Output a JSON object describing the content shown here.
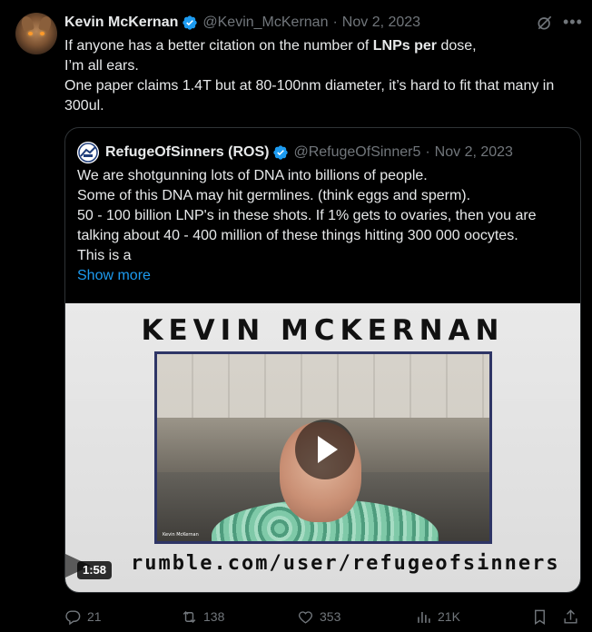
{
  "tweet": {
    "author_name": "Kevin McKernan",
    "handle": "@Kevin_McKernan",
    "date": "Nov 2, 2023",
    "text_line1_a": "If anyone has a better citation on the number of ",
    "text_line1_bold": "LNPs per",
    "text_line1_b": " dose,",
    "text_line2": "I’m all ears.",
    "text_line3": "One paper claims 1.4T but at 80-100nm diameter, it’s hard to fit that many in 300ul."
  },
  "quote": {
    "author_name": "RefugeOfSinners (ROS)",
    "handle": "@RefugeOfSinner5",
    "date": "Nov 2, 2023",
    "lines": [
      "We are shotgunning lots of DNA into billions of people.",
      "Some of this DNA may hit germlines. (think eggs and sperm).",
      "50 - 100 billion LNP's in these shots.  If 1% gets to ovaries, then you are talking about 40 - 400 million of these things hitting 300 000 oocytes.",
      "This is a"
    ],
    "show_more": "Show more",
    "media": {
      "title": "KEVIN MCKERNAN",
      "url_text": "rumble.com/user/refugeofsinners",
      "caption": "Kevin McKernan",
      "duration": "1:58"
    }
  },
  "actions": {
    "replies": "21",
    "reposts": "138",
    "likes": "353",
    "views": "21K"
  },
  "colors": {
    "background": "#000000",
    "text": "#e7e9ea",
    "muted": "#71767b",
    "link": "#1d9bf0",
    "verified": "#1d9bf0"
  }
}
